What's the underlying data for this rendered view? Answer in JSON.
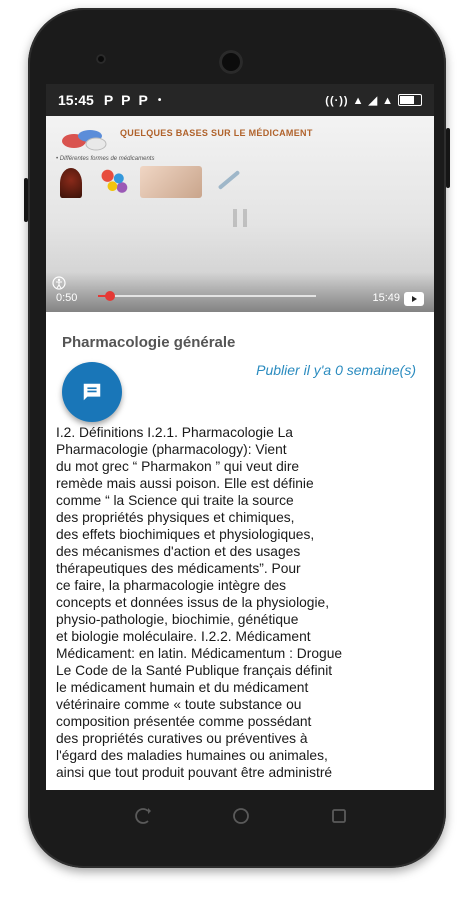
{
  "statusbar": {
    "time": "15:45",
    "notifications": [
      "P",
      "P",
      "P"
    ],
    "dot": "•",
    "system_icons": "((·)) ▲ ◢ ▲"
  },
  "video": {
    "slide_title": "QUELQUES BASES SUR LE MÉDICAMENT",
    "slide_subtitle": "• Différentes formes de médicaments",
    "elapsed": "0:50",
    "duration": "15:49",
    "progress": 0.053,
    "youtube_icon": "youtube-icon"
  },
  "article": {
    "title": "Pharmacologie générale",
    "published": "Publier il y'a 0 semaine(s)",
    "body": "I.2. Définitions  I.2.1. Pharmacologie La\nPharmacologie (pharmacology): Vient\ndu mot grec “ Pharmakon ” qui veut dire\nremède mais aussi poison. Elle est définie\ncomme “ la Science qui traite la source\ndes propriétés physiques et chimiques,\ndes effets biochimiques et physiologiques,\ndes mécanismes d'action et des usages\nthérapeutiques des médicaments”. Pour\nce faire, la pharmacologie intègre des\nconcepts et données issus de la physiologie,\nphysio-pathologie, biochimie, génétique\net biologie moléculaire. I.2.2. Médicament\nMédicament: en latin. Médicamentum : Drogue\nLe Code de la Santé Publique français définit\nle médicament humain et du médicament\nvétérinaire comme « toute substance ou\ncomposition présentée comme possédant\ndes propriétés curatives ou préventives à\nl'égard des maladies humaines ou animales,\nainsi que tout produit pouvant être administré"
  },
  "colors": {
    "fab": "#1976b8",
    "publish": "#2a8bbf",
    "progress": "#e53935"
  }
}
